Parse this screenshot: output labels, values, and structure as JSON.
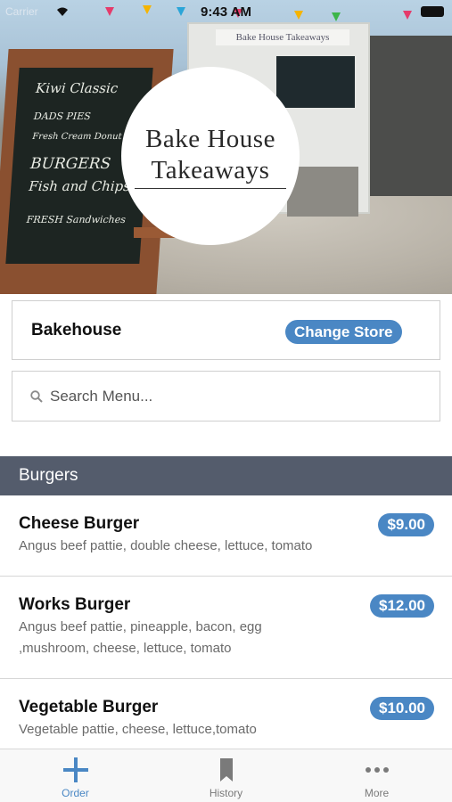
{
  "status_bar": {
    "carrier": "Carrier",
    "time": "9:43 AM"
  },
  "hero": {
    "logo_line1": "Bake House",
    "logo_line2": "Takeaways",
    "truck_sign": "Bake House Takeaways",
    "chalkboard_lines": [
      "Kiwi Classic",
      "DADS PIES",
      "Fresh Cream Donut",
      "BURGERS",
      "Fish and Chips",
      "FRESH Sandwiches"
    ]
  },
  "store": {
    "name": "Bakehouse",
    "change_label": "Change Store"
  },
  "search": {
    "placeholder": "Search Menu..."
  },
  "category": {
    "title": "Burgers"
  },
  "menu_items": [
    {
      "name": "Cheese Burger",
      "description": "Angus beef pattie, double cheese, lettuce, tomato",
      "price": "$9.00"
    },
    {
      "name": "Works Burger",
      "description": "Angus beef pattie, pineapple, bacon, egg ,mushroom, cheese, lettuce, tomato",
      "price": "$12.00"
    },
    {
      "name": "Vegetable Burger",
      "description": "Vegetable pattie, cheese, lettuce,tomato",
      "price": "$10.00"
    }
  ],
  "tab_bar": {
    "tabs": [
      {
        "label": "Order",
        "icon": "plus-icon",
        "active": true
      },
      {
        "label": "History",
        "icon": "bookmark-icon",
        "active": false
      },
      {
        "label": "More",
        "icon": "ellipsis-icon",
        "active": false
      }
    ]
  },
  "colors": {
    "accent": "#4a87c4",
    "category_bg": "#545c6c",
    "text_secondary": "#6a6a6a"
  }
}
